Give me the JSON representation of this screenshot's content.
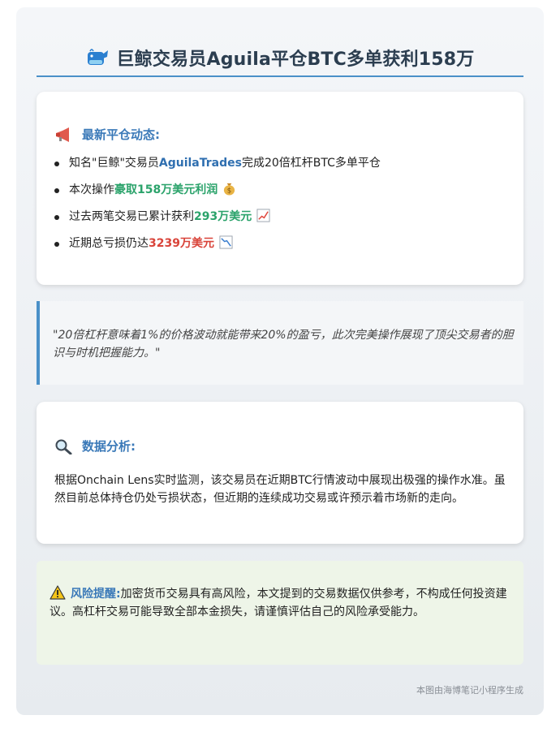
{
  "title": {
    "icon": "whale-icon",
    "text": "巨鲸交易员Aguila平仓BTC多单获利158万"
  },
  "latest_section": {
    "icon": "megaphone-icon",
    "heading": "最新平仓动态:",
    "items": [
      {
        "prefix": "知名\"巨鲸\"交易员",
        "highlight": "AguilaTrades",
        "suffix": "完成20倍杠杆BTC多单平仓"
      },
      {
        "prefix": "本次操作",
        "highlight": "豪取158万美元利润",
        "emoji": "money-bag-icon"
      },
      {
        "prefix": "过去两笔交易已累计获利",
        "highlight": "293万美元",
        "emoji": "chart-up-icon"
      },
      {
        "prefix": "近期总亏损仍达",
        "highlight": "3239万美元",
        "emoji": "chart-down-icon"
      }
    ]
  },
  "quote": "\"20倍杠杆意味着1%的价格波动就能带来20%的盈亏，此次完美操作展现了顶尖交易者的胆识与时机把握能力。\"",
  "analysis_section": {
    "icon": "magnifier-icon",
    "heading": "数据分析:",
    "body": "根据Onchain Lens实时监测，该交易员在近期BTC行情波动中展现出极强的操作水准。虽然目前总体持仓仍处亏损状态，但近期的连续成功交易或许预示着市场新的走向。"
  },
  "risk_section": {
    "icon": "warning-icon",
    "label": "风险提醒:",
    "body": "加密货币交易具有高风险，本文提到的交易数据仅供参考，不构成任何投资建议。高杠杆交易可能导致全部本金损失，请谨慎评估自己的风险承受能力。"
  },
  "footer": "本图由海博笔记小程序生成",
  "colors": {
    "accent": "#4a90c8",
    "heading_blue": "#3a79b8",
    "green": "#2ba36b",
    "red": "#d9443a"
  }
}
